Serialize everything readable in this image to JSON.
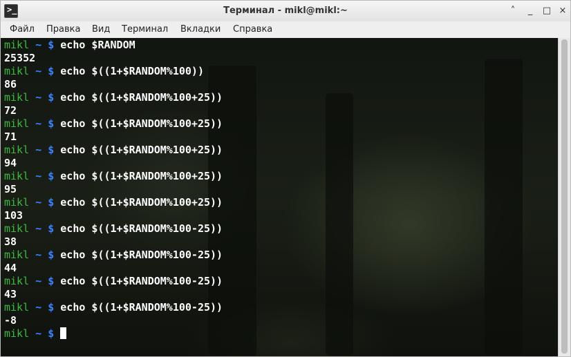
{
  "window": {
    "title": "Терминал - mikl@mikl:~",
    "app_icon": "terminal-icon",
    "app_icon_glyph": ">_",
    "buttons": {
      "menu": "˄",
      "minimize": "_",
      "maximize": "□",
      "close": "×"
    }
  },
  "menu": {
    "items": [
      "Файл",
      "Правка",
      "Вид",
      "Терминал",
      "Вкладки",
      "Справка"
    ]
  },
  "terminal": {
    "prompt": {
      "user": "mikl",
      "path": "~",
      "symbol": "$"
    },
    "entries": [
      {
        "command": "echo $RANDOM",
        "output": "25352"
      },
      {
        "command": "echo $((1+$RANDOM%100))",
        "output": "86"
      },
      {
        "command": "echo $((1+$RANDOM%100+25))",
        "output": "72"
      },
      {
        "command": "echo $((1+$RANDOM%100+25))",
        "output": "71"
      },
      {
        "command": "echo $((1+$RANDOM%100+25))",
        "output": "94"
      },
      {
        "command": "echo $((1+$RANDOM%100+25))",
        "output": "95"
      },
      {
        "command": "echo $((1+$RANDOM%100+25))",
        "output": "103"
      },
      {
        "command": "echo $((1+$RANDOM%100-25))",
        "output": "38"
      },
      {
        "command": "echo $((1+$RANDOM%100-25))",
        "output": "44"
      },
      {
        "command": "echo $((1+$RANDOM%100-25))",
        "output": "43"
      },
      {
        "command": "echo $((1+$RANDOM%100-25))",
        "output": "-8"
      }
    ],
    "colors": {
      "user": "#3fb93f",
      "path": "#3b82ff",
      "text": "#ffffff"
    }
  }
}
